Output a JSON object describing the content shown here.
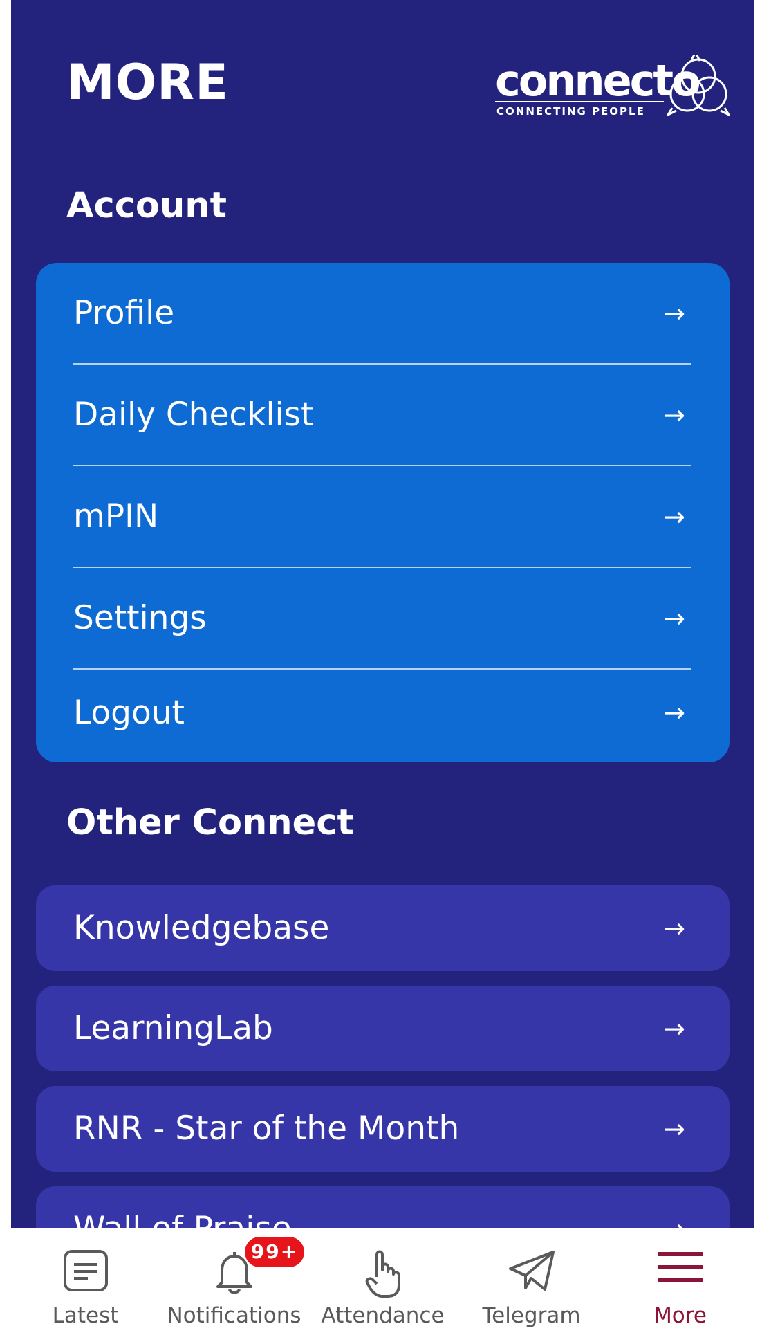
{
  "header": {
    "title": "MORE",
    "logo_word": "connecto",
    "logo_tagline": "CONNECTING PEOPLE"
  },
  "sections": {
    "account_title": "Account",
    "other_title": "Other Connect"
  },
  "account_items": [
    {
      "label": "Profile"
    },
    {
      "label": "Daily Checklist"
    },
    {
      "label": "mPIN"
    },
    {
      "label": "Settings"
    },
    {
      "label": "Logout"
    }
  ],
  "other_items": [
    {
      "label": "Knowledgebase"
    },
    {
      "label": "LearningLab"
    },
    {
      "label": "RNR - Star of the Month"
    },
    {
      "label": "Wall of Praise"
    }
  ],
  "arrow_glyph": "→",
  "bottom_nav": {
    "items": [
      {
        "label": "Latest",
        "icon": "document-icon"
      },
      {
        "label": "Notifications",
        "icon": "bell-icon",
        "badge": "99+"
      },
      {
        "label": "Attendance",
        "icon": "hand-pointer-icon"
      },
      {
        "label": "Telegram",
        "icon": "paper-plane-icon"
      },
      {
        "label": "More",
        "icon": "hamburger-icon",
        "active": true
      }
    ]
  },
  "colors": {
    "background": "#23237d",
    "account_card": "#0f6bd4",
    "other_card": "#3636a8",
    "active_nav": "#8b1538",
    "badge": "#e5151b"
  }
}
